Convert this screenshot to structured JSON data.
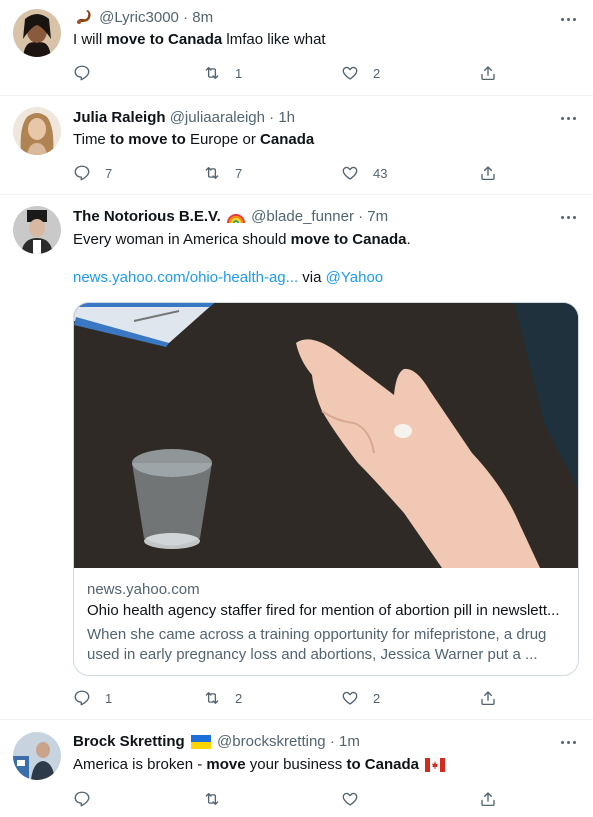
{
  "tweets": [
    {
      "name": "",
      "name_prefix_icon": "scorpion-emoji",
      "handle": "@Lyric3000",
      "dot": "·",
      "time": "8m",
      "text_parts": [
        "I will ",
        "move to Canada",
        " lmfao like what"
      ],
      "reply_count": "",
      "retweet_count": "1",
      "like_count": "2"
    },
    {
      "name": "Julia Raleigh",
      "handle": "@juliaaraleigh",
      "dot": "·",
      "time": "1h",
      "text_parts": [
        "Time ",
        "to move to",
        " Europe or ",
        "Canada"
      ],
      "reply_count": "7",
      "retweet_count": "7",
      "like_count": "43"
    },
    {
      "name": "The Notorious B.E.V.",
      "name_suffix_icon": "rainbow-emoji",
      "handle": "@blade_funner",
      "dot": "·",
      "time": "7m",
      "text_parts": [
        "Every woman in America should ",
        "move to Canada",
        "."
      ],
      "link_text": "news.yahoo.com/ohio-health-ag...",
      "via_text": " via ",
      "via_handle": "@Yahoo",
      "card": {
        "domain": "news.yahoo.com",
        "title": "Ohio health agency staffer fired for mention of abortion pill in newslett...",
        "description_line1": "When she came across a training opportunity for mifepristone, a drug",
        "description_line2": "used in early pregnancy loss and abortions, Jessica Warner put a ...",
        "image_icon": "hand-holding-pill-photo"
      },
      "reply_count": "1",
      "retweet_count": "2",
      "like_count": "2"
    },
    {
      "name": "Brock Skretting",
      "name_suffix_icon": "ukraine-flag-emoji",
      "handle": "@brockskretting",
      "dot": "·",
      "time": "1m",
      "text_parts": [
        "America is broken - ",
        "move",
        " your business ",
        "to Canada",
        " "
      ],
      "text_suffix_icon": "canada-flag-emoji",
      "reply_count": "",
      "retweet_count": "",
      "like_count": ""
    }
  ],
  "colors": {
    "text": "#0f1419",
    "secondary": "#536471",
    "link": "#1d9bf0",
    "border": "#eff3f4",
    "card_border": "#cfd9de"
  }
}
